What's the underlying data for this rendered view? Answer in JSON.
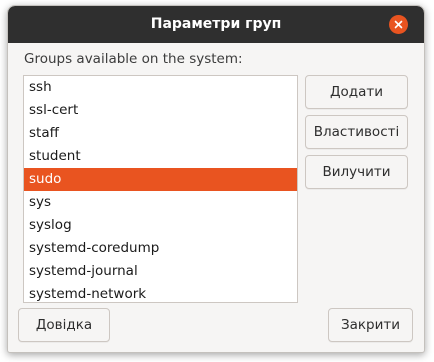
{
  "window": {
    "title": "Параметри груп"
  },
  "groups": {
    "label": "Groups available on the system:",
    "items": [
      {
        "label": "ssh"
      },
      {
        "label": "ssl-cert"
      },
      {
        "label": "staff"
      },
      {
        "label": "student"
      },
      {
        "label": "sudo"
      },
      {
        "label": "sys"
      },
      {
        "label": "syslog"
      },
      {
        "label": "systemd-coredump"
      },
      {
        "label": "systemd-journal"
      },
      {
        "label": "systemd-network"
      }
    ],
    "selected": "sudo"
  },
  "buttons": {
    "add": "Додати",
    "properties": "Властивості",
    "remove": "Вилучити",
    "help": "Довідка",
    "close": "Закрити"
  },
  "colors": {
    "accent": "#e95420",
    "titlebar": "#2f2f2f"
  }
}
